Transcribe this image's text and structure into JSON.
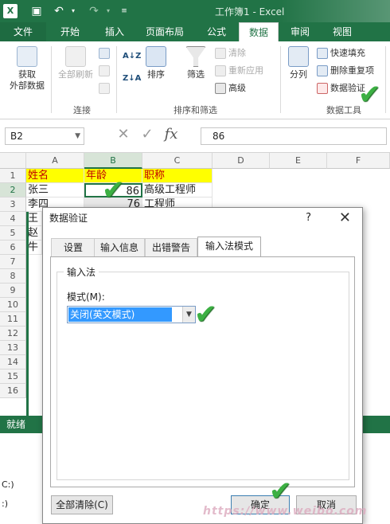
{
  "window": {
    "title": "工作簿1 - Excel"
  },
  "ribbon_tabs": [
    {
      "label": "文件"
    },
    {
      "label": "开始"
    },
    {
      "label": "插入"
    },
    {
      "label": "页面布局"
    },
    {
      "label": "公式"
    },
    {
      "label": "数据"
    },
    {
      "label": "审阅"
    },
    {
      "label": "视图"
    }
  ],
  "ribbon": {
    "get_external": "获取\n外部数据",
    "get_external_l1": "获取",
    "get_external_l2": "外部数据",
    "refresh_all": "全部刷新",
    "connections_group": "连接",
    "sort": "排序",
    "filter": "筛选",
    "clear": "清除",
    "reapply": "重新应用",
    "advanced": "高级",
    "sort_filter_group": "排序和筛选",
    "split": "分列",
    "flash_fill": "快速填充",
    "remove_dup": "删除重复项",
    "data_validation": "数据验证",
    "data_tools_group": "数据工具"
  },
  "formula_bar": {
    "name_box": "B2",
    "value": "86",
    "fx": "fx"
  },
  "columns": [
    "A",
    "B",
    "C",
    "D",
    "E",
    "F"
  ],
  "rows": [
    "1",
    "2",
    "3",
    "4",
    "5",
    "6",
    "7",
    "8",
    "9",
    "10",
    "11",
    "12",
    "13",
    "14",
    "15",
    "16"
  ],
  "cells": {
    "A1": "姓名",
    "B1": "年龄",
    "C1": "职称",
    "A2": "张三",
    "B2": "86",
    "C2": "高级工程师",
    "A3": "李四",
    "B3": "76",
    "C3": "工程师",
    "A4": "王",
    "A5": "赵",
    "A6": "牛"
  },
  "status": {
    "text": "就绪"
  },
  "below_text": {
    "line1": "C:)",
    "line2": ":)"
  },
  "dialog": {
    "title": "数据验证",
    "help": "?",
    "tabs": [
      {
        "label": "设置"
      },
      {
        "label": "输入信息"
      },
      {
        "label": "出错警告"
      },
      {
        "label": "输入法模式"
      }
    ],
    "group_label": "输入法",
    "mode_label": "模式(M):",
    "mode_value": "关闭(英文模式)",
    "clear_all": "全部清除(C)",
    "ok": "确定",
    "cancel": "取消"
  },
  "colors": {
    "excel_green": "#217346",
    "header_yellow": "#ffff00",
    "header_text_red": "#c00000",
    "selection_blue": "#3399ff",
    "check_green": "#3cb043"
  }
}
